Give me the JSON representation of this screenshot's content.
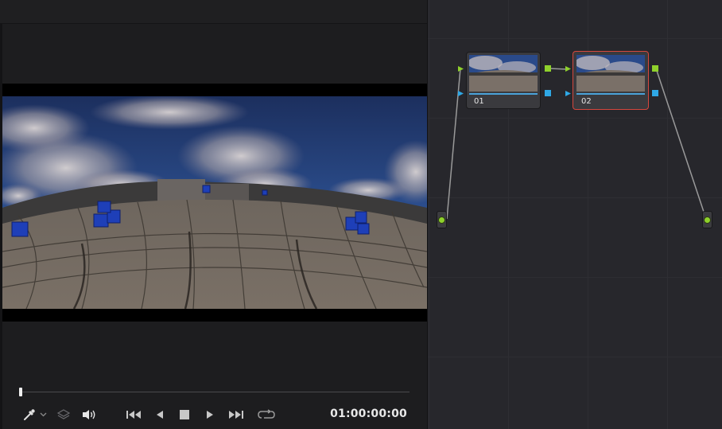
{
  "transport": {
    "timecode": "01:00:00:00",
    "playhead_position": 0
  },
  "node_editor": {
    "nodes": [
      {
        "label": "01",
        "selected": false
      },
      {
        "label": "02",
        "selected": true
      }
    ],
    "colors": {
      "rgb_port": "#8fd12c",
      "alpha_port": "#2fa8e6",
      "selected_outline": "#d6473d",
      "connection_line": "#9a9a9a"
    }
  },
  "icons": {
    "picker": "eyedropper-icon",
    "layers": "layers-icon",
    "audio": "speaker-icon",
    "first": "skip-to-start-icon",
    "reverse": "play-reverse-icon",
    "stop": "stop-icon",
    "play": "play-icon",
    "last": "skip-to-end-icon",
    "loop": "loop-icon"
  }
}
